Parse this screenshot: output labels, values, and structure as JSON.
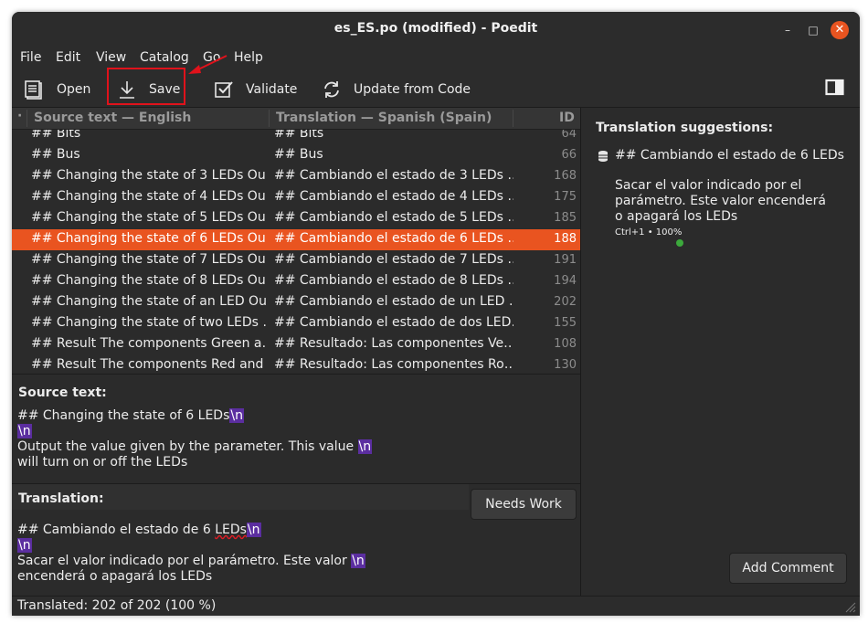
{
  "window": {
    "title": "es_ES.po (modified) - Poedit",
    "controls": {
      "minimize": "–",
      "maximize": "□",
      "close": "✕"
    }
  },
  "menu": [
    "File",
    "Edit",
    "View",
    "Catalog",
    "Go",
    "Help"
  ],
  "toolbar": {
    "open_label": "Open",
    "save_label": "Save",
    "validate_label": "Validate",
    "update_label": "Update from Code",
    "icons": [
      "document-open-icon",
      "save-download-icon",
      "check-icon",
      "refresh-icon",
      "sidebar-toggle-icon"
    ]
  },
  "list": {
    "headers": {
      "source": "Source text — English",
      "translation": "Translation — Spanish (Spain)",
      "id": "ID"
    },
    "rows": [
      {
        "source": "## Bits",
        "translation": "## Bits",
        "id": "64"
      },
      {
        "source": "## Bus",
        "translation": "## Bus",
        "id": "66"
      },
      {
        "source": "## Changing the state of 3 LEDs  Ou…",
        "translation": "## Cambiando el estado de 3 LEDs  …",
        "id": "168"
      },
      {
        "source": "## Changing the state of 4 LEDs  Ou…",
        "translation": "## Cambiando el estado de 4 LEDs  …",
        "id": "175"
      },
      {
        "source": "## Changing the state of 5 LEDs  Ou…",
        "translation": "## Cambiando el estado de 5 LEDs  …",
        "id": "185"
      },
      {
        "source": "## Changing the state of 6 LEDs  Ou…",
        "translation": "## Cambiando el estado de 6 LEDs  …",
        "id": "188",
        "selected": true
      },
      {
        "source": "## Changing the state of 7 LEDs  Ou…",
        "translation": "## Cambiando el estado de 7 LEDs  …",
        "id": "191"
      },
      {
        "source": "## Changing the state of 8 LEDs  Ou…",
        "translation": "## Cambiando el estado de 8 LEDs  …",
        "id": "194"
      },
      {
        "source": "## Changing the state of an LED  Ou…",
        "translation": "## Cambiando el estado de un LED  …",
        "id": "202"
      },
      {
        "source": "## Changing the state of two LEDs  …",
        "translation": "## Cambiando el estado de dos LED…",
        "id": "155"
      },
      {
        "source": "## Result  The components Green a…",
        "translation": "## Resultado:  Las componentes Ve…",
        "id": "108"
      },
      {
        "source": "## Result  The components Red and …",
        "translation": "## Resultado:  Las componentes Ro…",
        "id": "130"
      }
    ]
  },
  "source": {
    "label": "Source text:",
    "line1": "## Changing the state of 6 LEDs",
    "line3": "Output the value given by the parameter. This value ",
    "line4": "will turn on or off the LEDs",
    "newline_marker": "\\n"
  },
  "translation": {
    "label": "Translation:",
    "needs_work": "Needs Work",
    "line1_prefix": "## Cambiando el estado de 6 ",
    "line1_word": "LEDs",
    "line3": "Sacar el valor indicado por el parámetro. Este valor ",
    "line4": "encenderá o apagará los LEDs",
    "newline_marker": "\\n"
  },
  "suggestions": {
    "title": "Translation suggestions:",
    "heading": "## Cambiando el estado de 6 LEDs",
    "body": "Sacar el valor indicado por el parámetro. Este valor encenderá o apagará los LEDs",
    "meta": "Ctrl+1 • 100%",
    "add_comment": "Add Comment"
  },
  "status": {
    "text": "Translated: 202 of 202 (100 %)"
  },
  "colors": {
    "accent": "#e95420",
    "highlight_box": "#e0121b",
    "newline_marker_bg": "#5b2ea0"
  }
}
